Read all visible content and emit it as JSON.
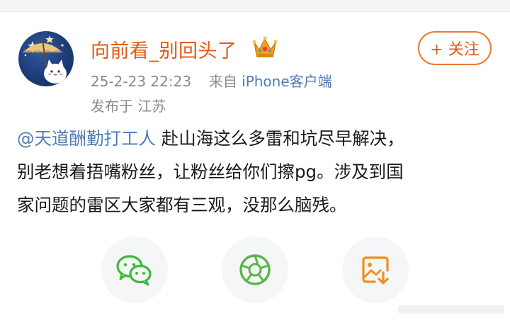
{
  "post": {
    "author": {
      "name": "向前看_别回头了",
      "badge_icon": "crown-icon"
    },
    "meta": {
      "datetime": "25-2-23 22:23",
      "source_prefix": "来自",
      "source": "iPhone客户端"
    },
    "location": "发布于 江苏",
    "follow_label": "+ 关注",
    "body": {
      "mention": "@天道酬勤打工人",
      "line1_rest": " 赴山海这么多雷和坑尽早解决，",
      "line2": "别老想着捂嘴粉丝，让粉丝给你们擦pg。涉及到国",
      "line3": "家问题的雷区大家都有三观，没那么脑残。"
    }
  },
  "share_actions": [
    {
      "name": "wechat",
      "icon": "wechat-icon"
    },
    {
      "name": "moments",
      "icon": "moments-icon"
    },
    {
      "name": "save-image",
      "icon": "save-image-icon"
    }
  ],
  "colors": {
    "username": "#e05a13",
    "link": "#4f7bb5",
    "follow_border": "#ea7a2f",
    "meta_text": "#8a8a8a",
    "wechat_green": "#3fb93a",
    "moments_green": "#58b847",
    "save_orange": "#f09020"
  }
}
